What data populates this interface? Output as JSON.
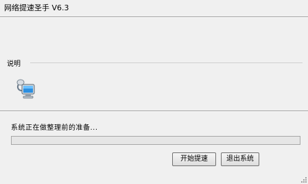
{
  "window": {
    "title": "网络提速圣手 V6.3"
  },
  "section": {
    "label": "说明"
  },
  "icons": {
    "main": "network-computer-icon"
  },
  "status": {
    "text": "系统正在做整理前的准备...",
    "progress": 0
  },
  "buttons": {
    "start_label": "开始提速",
    "exit_label": "退出系统"
  },
  "colors": {
    "background": "#f0f0f0",
    "progress_fill": "#06b025"
  }
}
